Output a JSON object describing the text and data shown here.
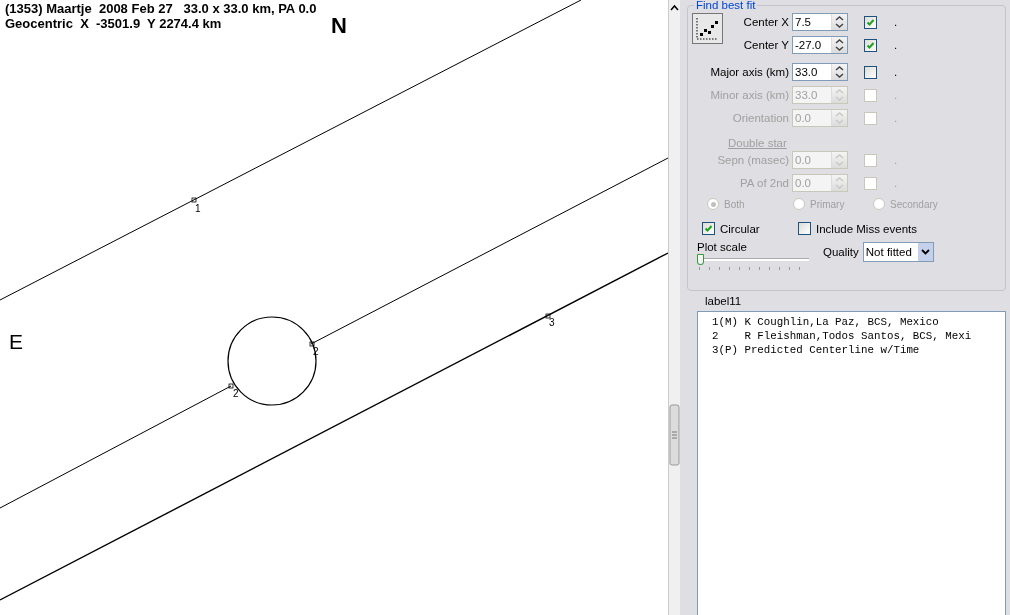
{
  "plot": {
    "title_line": "(1353) Maartje  2008 Feb 27   33.0 x 33.0 km, PA 0.0",
    "coords_line": "Geocentric  X  -3501.9  Y 2274.4 km",
    "north": "N",
    "east": "E",
    "chord_labels": [
      "1",
      "2",
      "2",
      "3"
    ]
  },
  "fit_panel": {
    "group_title": "Find best fit",
    "fields": [
      {
        "label": "Center X",
        "value": "7.5",
        "disabled": false,
        "checked": true,
        "mark": "."
      },
      {
        "label": "Center Y",
        "value": "-27.0",
        "disabled": false,
        "checked": true,
        "mark": "."
      },
      {
        "label": "Major axis (km)",
        "value": "33.0",
        "disabled": false,
        "checked": false,
        "mark": "."
      },
      {
        "label": "Minor axis (km)",
        "value": "33.0",
        "disabled": true,
        "checked": false,
        "mark": "."
      },
      {
        "label": "Orientation",
        "value": "0.0",
        "disabled": true,
        "checked": false,
        "mark": "."
      }
    ],
    "double_star": {
      "link": "Double star",
      "disabled": true,
      "fields": [
        {
          "label": "Sepn (masec)",
          "value": "0.0",
          "disabled": true,
          "checked": false,
          "mark": "."
        },
        {
          "label": "PA of 2nd",
          "value": "0.0",
          "disabled": true,
          "checked": false,
          "mark": "."
        }
      ],
      "radios": [
        {
          "label": "Both",
          "selected": true,
          "disabled": true
        },
        {
          "label": "Primary",
          "selected": false,
          "disabled": true
        },
        {
          "label": "Secondary",
          "selected": false,
          "disabled": true
        }
      ]
    },
    "options": [
      {
        "label": "Circular",
        "checked": true
      },
      {
        "label": "Include Miss events",
        "checked": false
      }
    ],
    "plot_scale": {
      "label": "Plot scale",
      "level": 0
    },
    "quality": {
      "label": "Quality",
      "value": "Not fitted"
    },
    "list_label": "label11",
    "list_items": [
      "1(M) K Coughlin,La Paz, BCS, Mexico",
      "2    R Fleishman,Todos Santos, BCS, Mexi",
      "3(P) Predicted Centerline w/Time"
    ]
  }
}
